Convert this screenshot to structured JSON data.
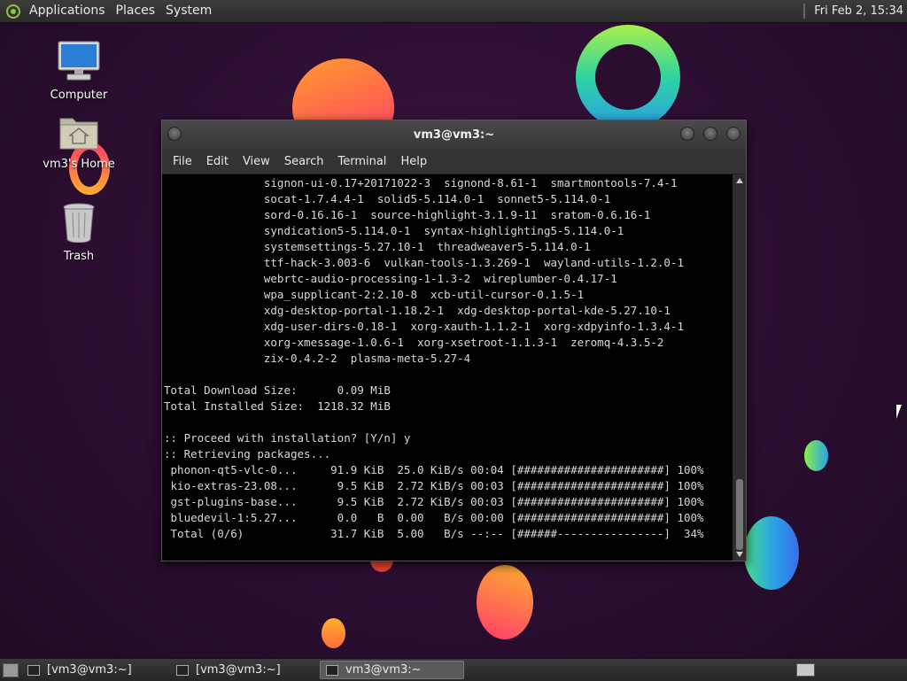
{
  "top_panel": {
    "menus": [
      "Applications",
      "Places",
      "System"
    ],
    "clock": "Fri Feb  2, 15:34"
  },
  "desktop_icons": [
    {
      "label": "Computer",
      "icon": "computer-icon"
    },
    {
      "label": "vm3's Home",
      "icon": "home-folder-icon"
    },
    {
      "label": "Trash",
      "icon": "trash-icon"
    }
  ],
  "window": {
    "title": "vm3@vm3:~",
    "menu": [
      "File",
      "Edit",
      "View",
      "Search",
      "Terminal",
      "Help"
    ]
  },
  "terminal": {
    "lines": [
      "               signon-ui-0.17+20171022-3  signond-8.61-1  smartmontools-7.4-1",
      "               socat-1.7.4.4-1  solid5-5.114.0-1  sonnet5-5.114.0-1",
      "               sord-0.16.16-1  source-highlight-3.1.9-11  sratom-0.6.16-1",
      "               syndication5-5.114.0-1  syntax-highlighting5-5.114.0-1",
      "               systemsettings-5.27.10-1  threadweaver5-5.114.0-1",
      "               ttf-hack-3.003-6  vulkan-tools-1.3.269-1  wayland-utils-1.2.0-1",
      "               webrtc-audio-processing-1-1.3-2  wireplumber-0.4.17-1",
      "               wpa_supplicant-2:2.10-8  xcb-util-cursor-0.1.5-1",
      "               xdg-desktop-portal-1.18.2-1  xdg-desktop-portal-kde-5.27.10-1",
      "               xdg-user-dirs-0.18-1  xorg-xauth-1.1.2-1  xorg-xdpyinfo-1.3.4-1",
      "               xorg-xmessage-1.0.6-1  xorg-xsetroot-1.1.3-1  zeromq-4.3.5-2",
      "               zix-0.4.2-2  plasma-meta-5.27-4",
      "",
      "Total Download Size:      0.09 MiB",
      "Total Installed Size:  1218.32 MiB",
      "",
      ":: Proceed with installation? [Y/n] y",
      ":: Retrieving packages...",
      " phonon-qt5-vlc-0...     91.9 KiB  25.0 KiB/s 00:04 [######################] 100%",
      " kio-extras-23.08...      9.5 KiB  2.72 KiB/s 00:03 [######################] 100%",
      " gst-plugins-base...      9.5 KiB  2.72 KiB/s 00:03 [######################] 100%",
      " bluedevil-1:5.27...      0.0   B  0.00   B/s 00:00 [######################] 100%",
      " Total (0/6)             31.7 KiB  5.00   B/s --:-- [######----------------]  34%"
    ]
  },
  "taskbar": {
    "tasks": [
      {
        "label": "[vm3@vm3:~]",
        "active": false
      },
      {
        "label": "[vm3@vm3:~]",
        "active": false
      },
      {
        "label": "vm3@vm3:~",
        "active": true
      }
    ]
  }
}
